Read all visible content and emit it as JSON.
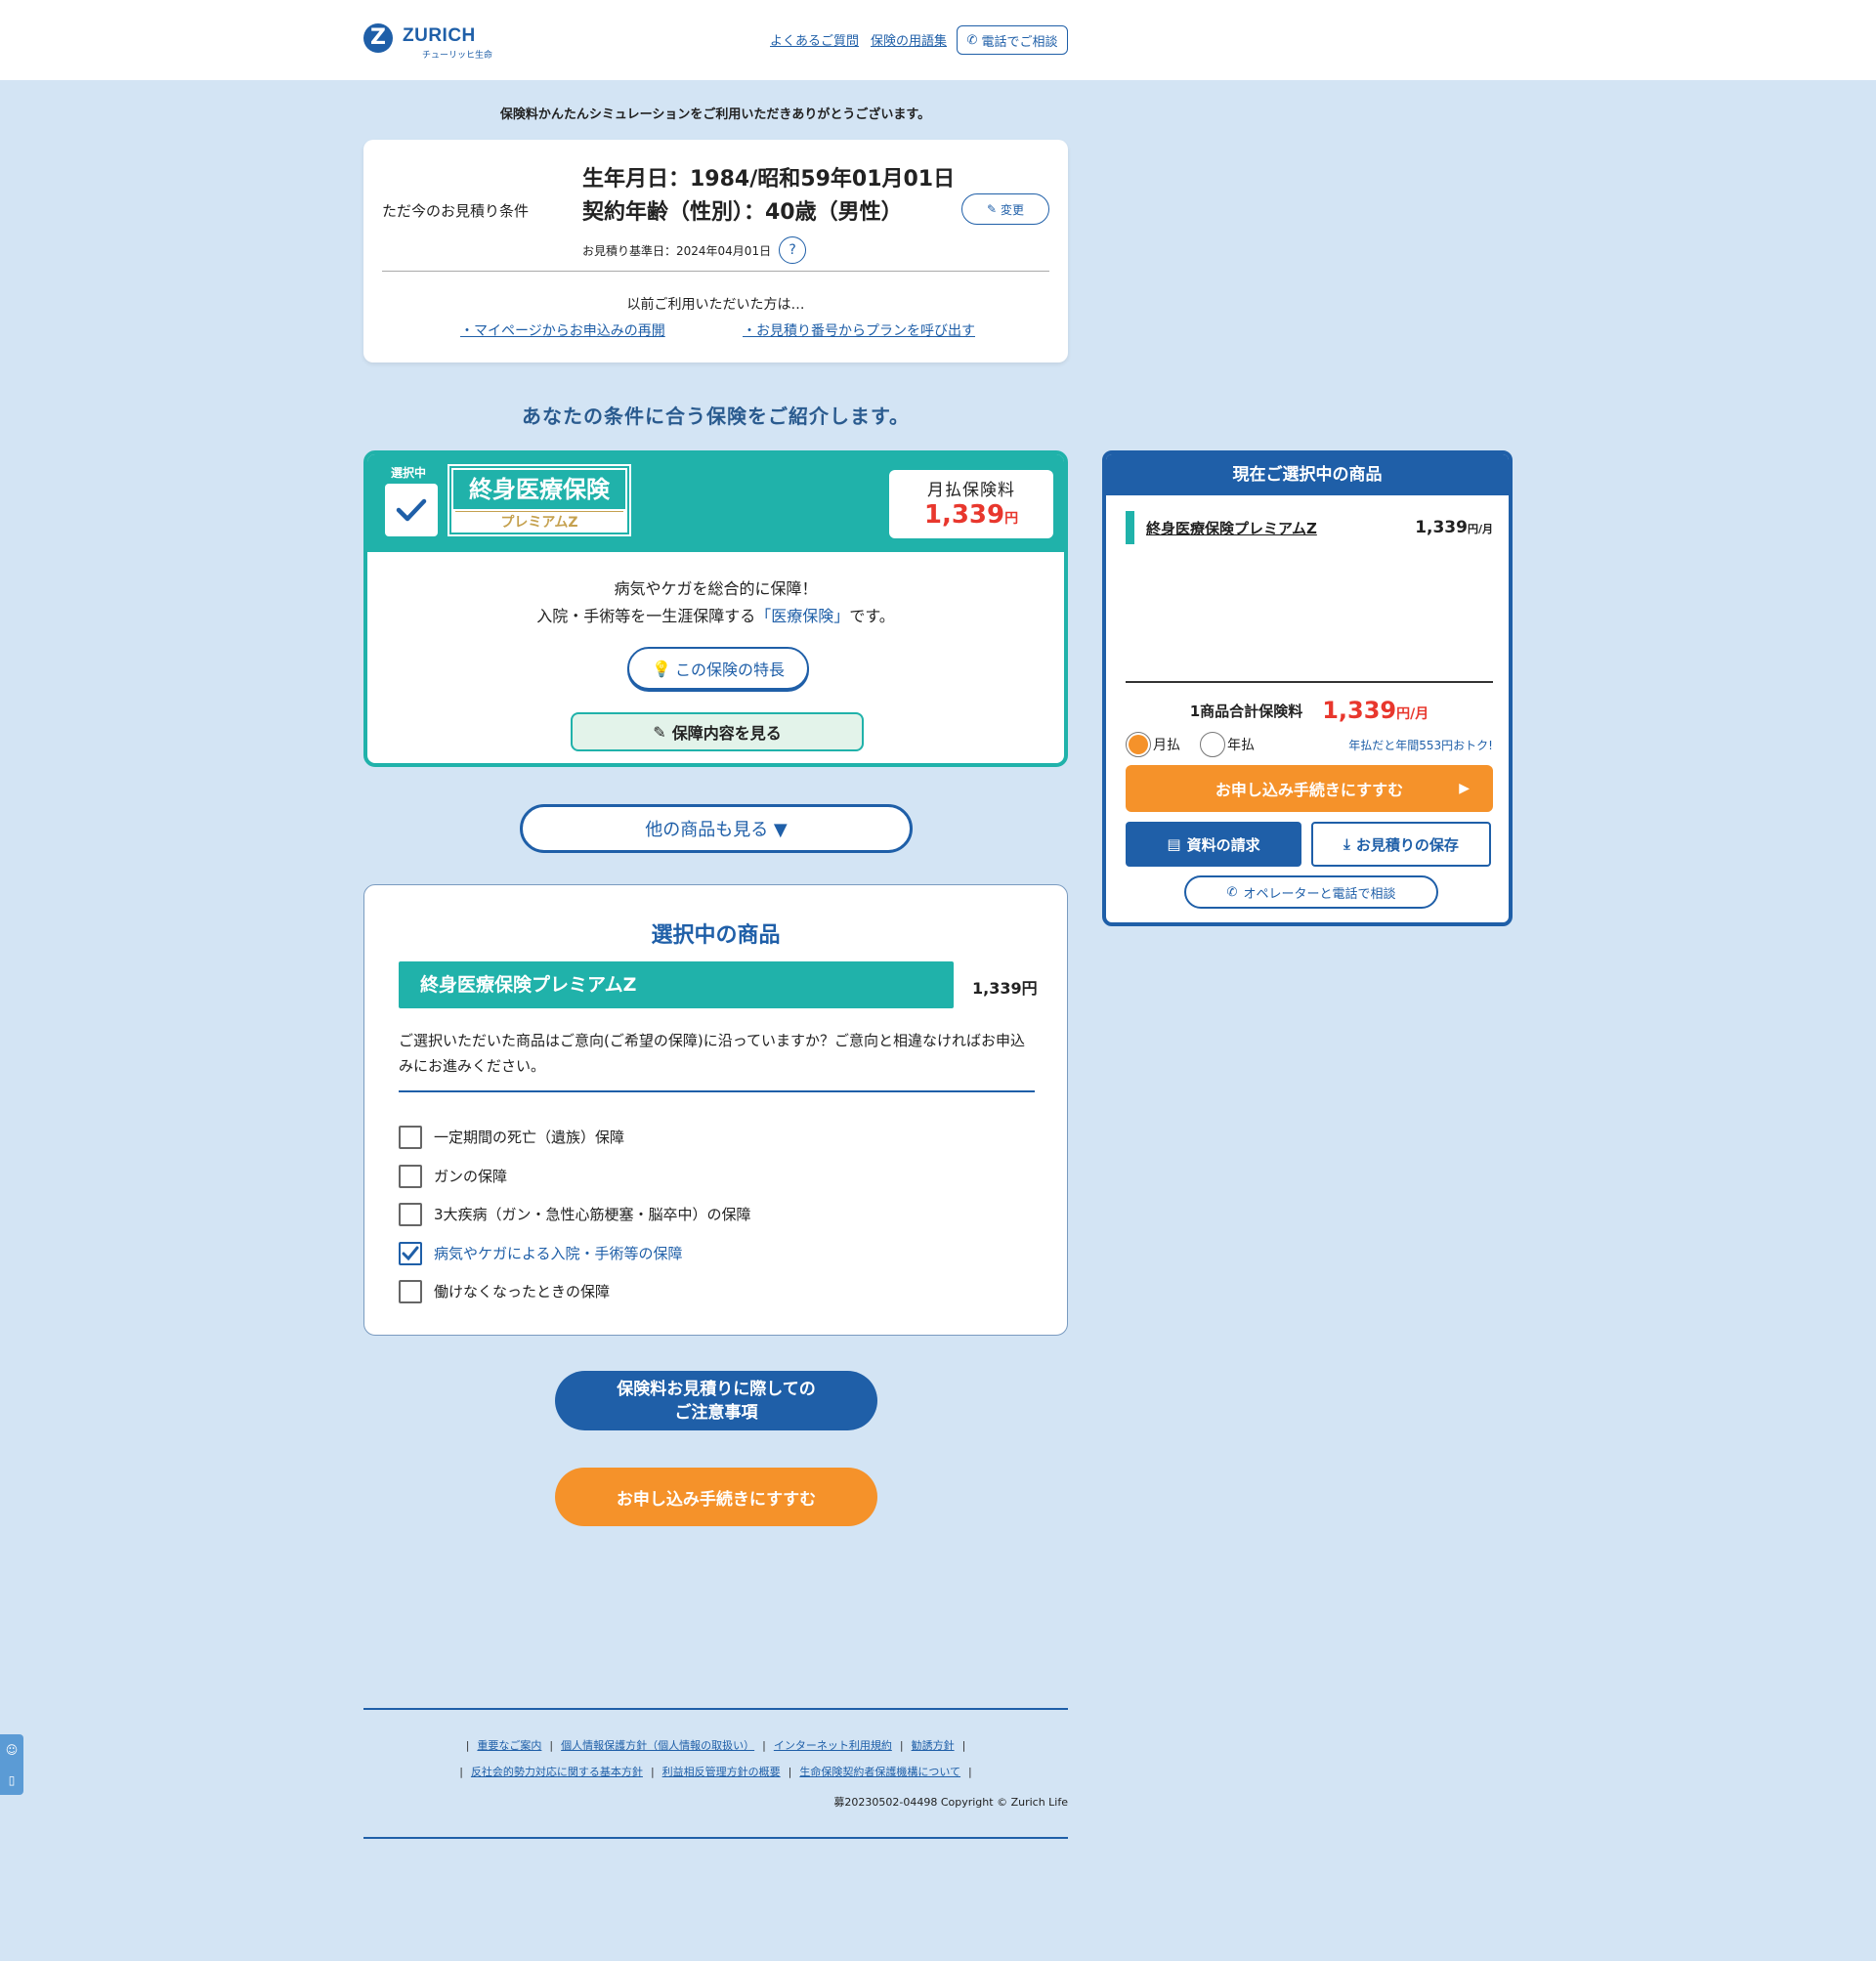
{
  "header": {
    "logo_word": "ZURICH",
    "logo_sub": "チューリッヒ生命",
    "faq_link": "よくあるご質問",
    "glossary_link": "保険の用語集",
    "tel_button": "電話でご相談"
  },
  "thanks_message": "保険料かんたんシミュレーションをご利用いただきありがとうございます。",
  "conditions": {
    "label": "ただ今のお見積り条件",
    "dob": "生年月日：1984/昭和59年01月01日",
    "age": "契約年齢（性別）：40歳（男性）",
    "base_date": "お見積り基準日：2024年04月01日",
    "help_icon": "?",
    "change_button": "変更",
    "prev_note": "以前ご利用いただいた方は…",
    "mypage_link": "・マイページからお申込みの再開",
    "quote_link": "・お見積り番号からプランを呼び出す"
  },
  "intro": "あなたの条件に合う保険をご紹介します。",
  "product": {
    "selected_tag": "選択中",
    "name": "終身医療保険",
    "subname": "プレミアムZ",
    "price_label": "月払保険料",
    "price": "1,339",
    "price_unit": "円",
    "desc_line1": "病気やケガを総合的に保障！",
    "desc_line2_a": "入院・手術等を一生涯保障する",
    "desc_line2_hl": "「医療保険」",
    "desc_line2_b": "です。",
    "feature_button": "この保険の特長",
    "coverage_button": "保障内容を見る"
  },
  "more_button": "他の商品も見る ▼",
  "selected": {
    "title": "選択中の商品",
    "product_name": "終身医療保険プレミアムZ",
    "price": "1,339円",
    "text": "ご選択いただいた商品はご意向(ご希望の保障)に沿っていますか？ご意向と相違なければお申込みにお進みください。",
    "checklist": [
      {
        "label": "一定期間の死亡（遺族）保障",
        "checked": false
      },
      {
        "label": "ガンの保障",
        "checked": false
      },
      {
        "label": "3大疾病（ガン・急性心筋梗塞・脳卒中）の保障",
        "checked": false
      },
      {
        "label": "病気やケガによる入院・手術等の保障",
        "checked": true
      },
      {
        "label": "働けなくなったときの保障",
        "checked": false
      }
    ]
  },
  "notice_button_line1": "保険料お見積りに際しての",
  "notice_button_line2": "ご注意事項",
  "apply_button": "お申し込み手続きにすすむ",
  "side": {
    "title": "現在ご選択中の商品",
    "item_name": "終身医療保険プレミアムZ",
    "item_price": "1,339",
    "item_unit": "円/月",
    "total_label": "1商品合計保険料",
    "total_price": "1,339",
    "total_unit": "円/月",
    "monthly": "月払",
    "annual": "年払",
    "annual_note": "年払だと年間553円おトク!",
    "apply_button": "お申し込み手続きにすすむ",
    "doc_button": "資料の請求",
    "save_button": "お見積りの保存",
    "operator_button": "オペレーターと電話で相談"
  },
  "footer": {
    "links_row1": [
      "重要なご案内",
      "個人情報保護方針（個人情報の取扱い）",
      "インターネット利用規約",
      "勧誘方針"
    ],
    "links_row2": [
      "反社会的勢力対応に関する基本方針",
      "利益相反管理方針の概要",
      "生命保険契約者保護機構について"
    ],
    "copyright": "募20230502-04498 Copyright © Zurich Life"
  },
  "colors": {
    "brand_blue": "#1f5fa8",
    "teal": "#20b2aa",
    "orange": "#f5922a",
    "price_red": "#e8372d",
    "page_bg": "#d3e4f4"
  }
}
